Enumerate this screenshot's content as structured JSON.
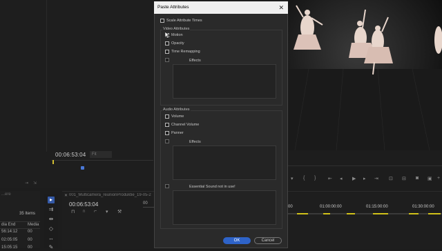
{
  "dialog": {
    "title": "Paste Attributes",
    "close_glyph": "✕",
    "scale_attribute_times": {
      "label": "Scale Attribute Times",
      "checked": false
    },
    "video_group": {
      "title": "Video Attributes",
      "items": [
        {
          "label": "Motion",
          "checked": false
        },
        {
          "label": "Opacity",
          "checked": false
        },
        {
          "label": "Time Remapping",
          "checked": false
        }
      ],
      "effects_label": "Effects"
    },
    "audio_group": {
      "title": "Audio Attributes",
      "items": [
        {
          "label": "Volume",
          "checked": false
        },
        {
          "label": "Channel Volume",
          "checked": false
        },
        {
          "label": "Panner",
          "checked": false
        }
      ],
      "effects_label": "Effects",
      "essential_sound_label": "Essential Sound not in use!"
    },
    "ok_label": "OK",
    "cancel_label": "Cancel"
  },
  "source_monitor": {
    "timecode": "00:06:53:04",
    "fit_label": "Fit"
  },
  "project_panel": {
    "name": "...ere",
    "item_count": "35 Items",
    "columns": [
      "dia End",
      "Media"
    ],
    "rows": [
      [
        "56:14:12",
        "00"
      ],
      [
        "02:05:05",
        "00"
      ],
      [
        "15:05:15",
        "00"
      ]
    ]
  },
  "timeline": {
    "sequence_name": "001_Multicamera_reunionProduktie_19-05-2",
    "timecode": "00:06:53:04",
    "ruler_label": "00"
  },
  "program_timeline": {
    "ticks": [
      "00",
      "01:00:00:00",
      "01:15:00:00",
      "01:30:00:00"
    ]
  },
  "icons": {
    "selection_tool": "arrow-icon",
    "track_select": "double-arrow-icon",
    "ripple": "ripple-icon",
    "razor": "razor-icon",
    "pen": "pen-icon"
  },
  "colors": {
    "accent": "#2e63c8",
    "playhead": "#4a78d6",
    "in_out_marker": "#d2c219"
  }
}
